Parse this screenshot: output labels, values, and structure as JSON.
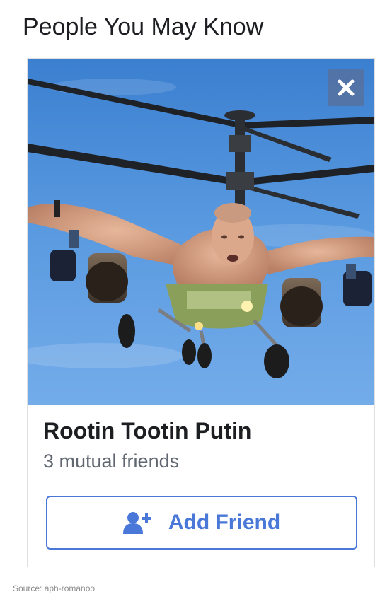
{
  "section": {
    "title": "People You May Know"
  },
  "suggestion": {
    "name": "Rootin Tootin Putin",
    "mutual_friends": "3 mutual friends",
    "add_friend_label": "Add Friend",
    "photo_icon": "profile-photo"
  },
  "icons": {
    "close": "close-icon",
    "add_friend": "add-person-icon"
  },
  "colors": {
    "accent": "#4a78d8",
    "name_text": "#1c1e21",
    "secondary_text": "#606770",
    "sky": "#4e8fd6",
    "card_border": "#dddfe2"
  },
  "footer": {
    "source": "Source: aph-romanoo"
  }
}
